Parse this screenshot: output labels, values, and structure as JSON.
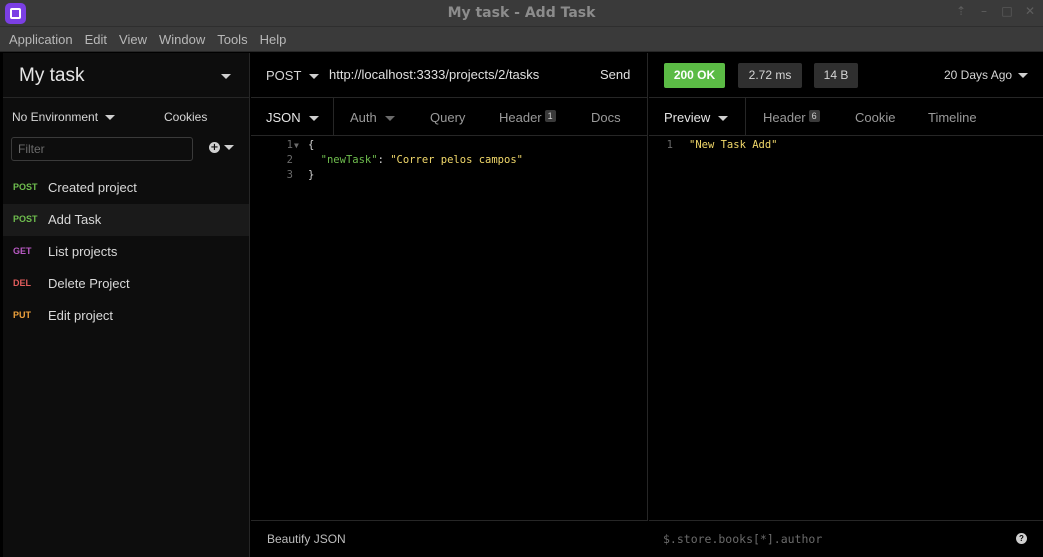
{
  "window": {
    "title": "My task - Add Task"
  },
  "menu": [
    "Application",
    "Edit",
    "View",
    "Window",
    "Tools",
    "Help"
  ],
  "sidebar": {
    "workspace": "My task",
    "environment": "No Environment",
    "cookies": "Cookies",
    "filter_placeholder": "Filter",
    "requests": [
      {
        "method": "POST",
        "name": "Created project"
      },
      {
        "method": "POST",
        "name": "Add Task"
      },
      {
        "method": "GET",
        "name": "List projects"
      },
      {
        "method": "DEL",
        "name": "Delete Project"
      },
      {
        "method": "PUT",
        "name": "Edit project"
      }
    ]
  },
  "request": {
    "method": "POST",
    "url": "http://localhost:3333/projects/2/tasks",
    "send": "Send",
    "tabs": {
      "body": "JSON",
      "auth": "Auth",
      "query": "Query",
      "header": "Header",
      "header_count": "1",
      "docs": "Docs"
    },
    "body_lines": [
      "{",
      "  \"newTask\": \"Correr pelos campos\"",
      "}"
    ],
    "body_key": "\"newTask\"",
    "body_value": "\"Correr pelos campos\"",
    "line_numbers": [
      "1",
      "2",
      "3"
    ],
    "beautify": "Beautify JSON"
  },
  "response": {
    "status": "200 OK",
    "time": "2.72 ms",
    "size": "14 B",
    "time_ago": "20 Days Ago",
    "tabs": {
      "preview": "Preview",
      "header": "Header",
      "header_count": "6",
      "cookie": "Cookie",
      "timeline": "Timeline"
    },
    "body_line": "\"New Task Add\"",
    "line_number": "1",
    "filter_placeholder": "$.store.books[*].author"
  },
  "colors": {
    "accent": "#7b3fe4",
    "status_ok": "#5bbb45",
    "post": "#6fbe4e",
    "get": "#b95ac4",
    "del": "#e35d5d",
    "put": "#f1a33c",
    "string": "#f1d86a"
  }
}
